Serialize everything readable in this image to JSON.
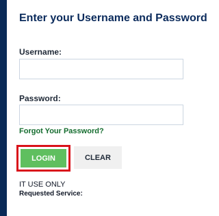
{
  "form": {
    "title": "Enter your Username and Password",
    "username_label": "Username:",
    "username_value": "",
    "password_label": "Password:",
    "password_value": "",
    "forgot_password": "Forgot Your Password?",
    "login_label": "LOGIN",
    "clear_label": "CLEAR",
    "it_use_only": "IT USE ONLY",
    "requested_service": "Requested Service:"
  },
  "colors": {
    "title": "#0b2b5c",
    "left_border": "#0a2a57",
    "login_button": "#5fbf5f",
    "highlight": "#d9111a",
    "link": "#146c2e"
  }
}
